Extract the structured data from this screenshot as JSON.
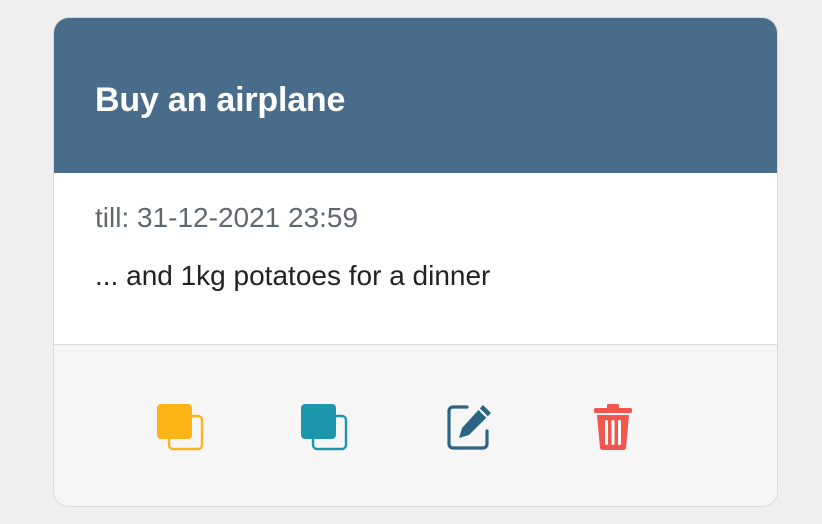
{
  "task": {
    "title": "Buy an airplane",
    "deadline": "till: 31-12-2021 23:59",
    "description": "... and 1kg potatoes for a dinner"
  },
  "actions": [
    {
      "name": "copy-yellow-icon",
      "color": "#fbb315"
    },
    {
      "name": "copy-teal-icon",
      "color": "#1d95ab"
    },
    {
      "name": "edit-icon",
      "color": "#2c6485"
    },
    {
      "name": "trash-icon",
      "color": "#f2574f"
    }
  ],
  "colors": {
    "header_bg": "#486c8a",
    "footer_bg": "#f6f6f6",
    "page_bg": "#efefef"
  }
}
